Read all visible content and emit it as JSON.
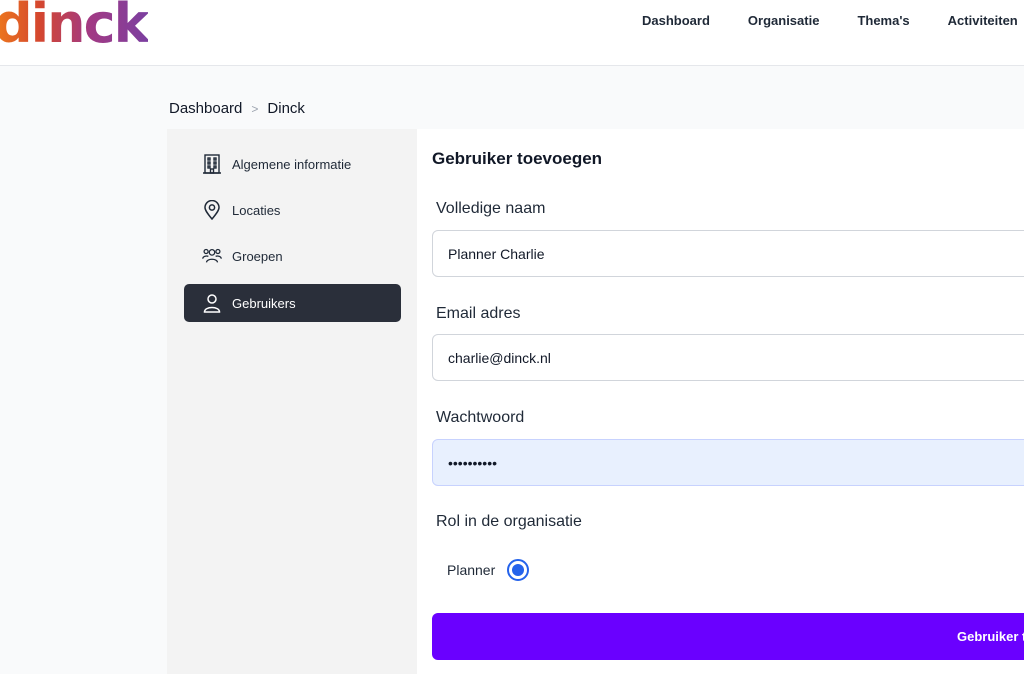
{
  "header": {
    "logo_text": "dinck",
    "nav": [
      "Dashboard",
      "Organisatie",
      "Thema's",
      "Activiteiten"
    ]
  },
  "breadcrumb": {
    "items": [
      "Dashboard",
      "Dinck"
    ],
    "separator": ">"
  },
  "sidebar": {
    "items": [
      {
        "label": "Algemene informatie",
        "icon": "building-icon"
      },
      {
        "label": "Locaties",
        "icon": "location-pin-icon"
      },
      {
        "label": "Groepen",
        "icon": "users-group-icon"
      },
      {
        "label": "Gebruikers",
        "icon": "user-icon",
        "active": true
      }
    ]
  },
  "form": {
    "title": "Gebruiker toevoegen",
    "name_label": "Volledige naam",
    "name_value": "Planner Charlie",
    "email_label": "Email adres",
    "email_value": "charlie@dinck.nl",
    "password_label": "Wachtwoord",
    "password_value": "••••••••••",
    "role_label": "Rol in de organisatie",
    "role_option": "Planner",
    "role_selected": true,
    "submit_label": "Gebruiker t"
  },
  "colors": {
    "submit_bg": "#6a00ff",
    "active_sidebar_bg": "#2a2f3a",
    "radio_accent": "#2563eb",
    "autofill_bg": "#e8f0fe"
  }
}
